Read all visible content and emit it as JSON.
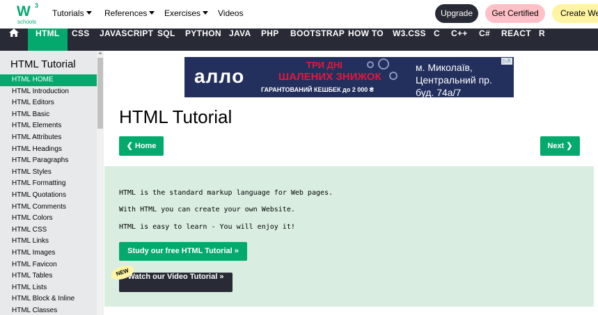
{
  "logo": {
    "mark": "W",
    "sup": "3",
    "sub": "schools"
  },
  "topnav": {
    "items": [
      {
        "label": "Tutorials",
        "dropdown": true
      },
      {
        "label": "References",
        "dropdown": true
      },
      {
        "label": "Exercises",
        "dropdown": true
      },
      {
        "label": "Videos",
        "dropdown": false
      }
    ],
    "upgrade": "Upgrade",
    "certified": "Get Certified",
    "create": "Create Web"
  },
  "darknav": {
    "home_icon": "home-icon",
    "items": [
      "HTML",
      "CSS",
      "JAVASCRIPT",
      "SQL",
      "PYTHON",
      "JAVA",
      "PHP",
      "BOOTSTRAP",
      "HOW TO",
      "W3.CSS",
      "C",
      "C++",
      "C#",
      "REACT",
      "R"
    ],
    "active": "HTML"
  },
  "sidebar": {
    "title": "HTML Tutorial",
    "items": [
      "HTML HOME",
      "HTML Introduction",
      "HTML Editors",
      "HTML Basic",
      "HTML Elements",
      "HTML Attributes",
      "HTML Headings",
      "HTML Paragraphs",
      "HTML Styles",
      "HTML Formatting",
      "HTML Quotations",
      "HTML Comments",
      "HTML Colors",
      "HTML CSS",
      "HTML Links",
      "HTML Images",
      "HTML Favicon",
      "HTML Tables",
      "HTML Lists",
      "HTML Block & Inline",
      "HTML Classes"
    ],
    "active_index": 0
  },
  "ad": {
    "logo": "аллo",
    "line1": "ТРИ ДНІ",
    "line2": "ШАЛЕНИХ ЗНИЖОК",
    "line3": "ГАРАНТОВАНИЙ КЕШБЕК до 2 000 ₴",
    "city1": "м. Миколаїв,",
    "city2": "Центральний пр.",
    "city3": "буд. 74а/7",
    "close": "▷X"
  },
  "main": {
    "title": "HTML Tutorial",
    "home_button": "❮ Home",
    "next_button": "Next ❯",
    "paragraphs": [
      "HTML is the standard markup language for Web pages.",
      "With HTML you can create your own Website.",
      "HTML is easy to learn - You will enjoy it!"
    ],
    "study_button": "Study our free HTML Tutorial »",
    "video_button": "Watch our Video Tutorial »",
    "new_badge": "NEW"
  },
  "colors": {
    "accent": "#04AA6D",
    "dark": "#282A35",
    "sidebar_bg": "#E7E9EB",
    "intro_bg": "#D9EEE1",
    "pink": "#FFC0C7",
    "yellow": "#FFF4A3"
  }
}
